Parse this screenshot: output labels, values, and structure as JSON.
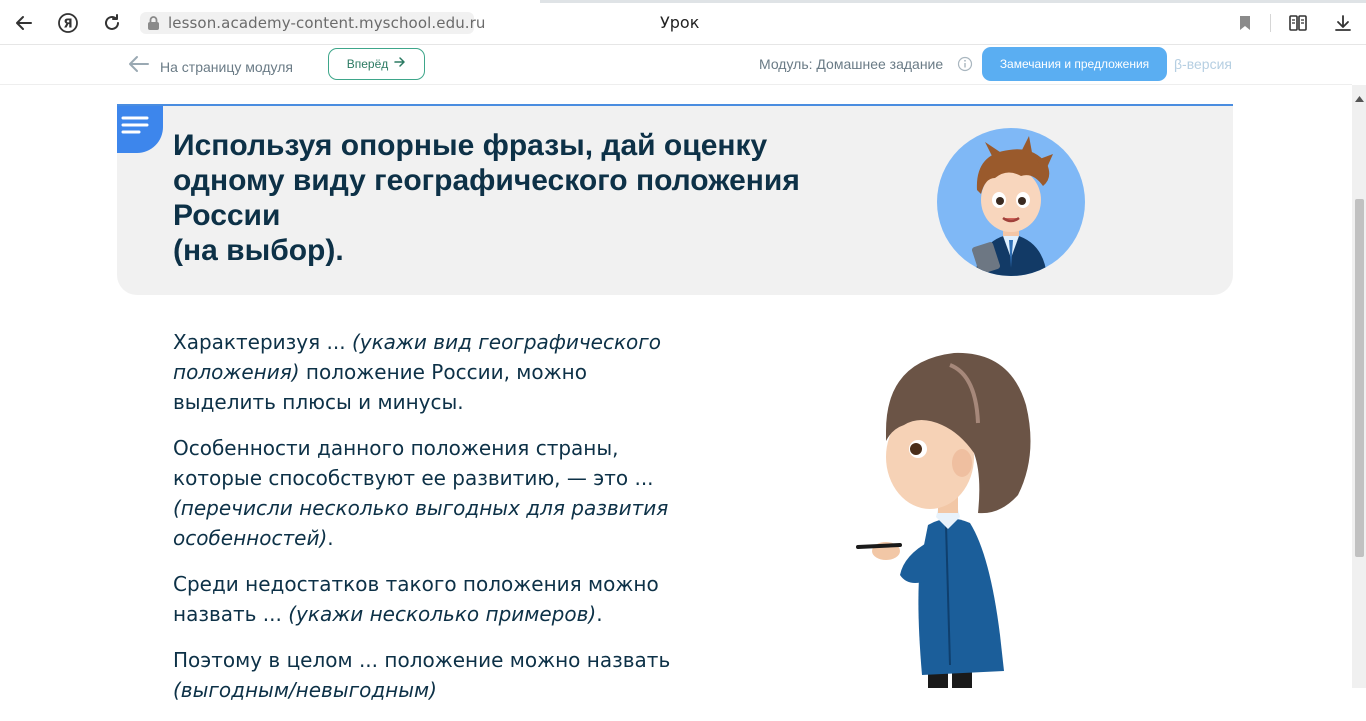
{
  "browser": {
    "address": "lesson.academy-content.myschool.edu.ru",
    "tab_title": "Урок"
  },
  "lesson_header": {
    "back_label": "На страницу модуля",
    "forward_label": "Вперёд",
    "module_label": "Модуль: Домашнее задание",
    "feedback_label": "Замечания и предложения",
    "beta_label": "β-версия"
  },
  "task": {
    "title_line1": "Используя опорные фразы, дай оценку",
    "title_line2": "одному виду географического положения",
    "title_line3": "России",
    "title_line4": "(на выбор)."
  },
  "body": {
    "p1_a": "Характеризуя ... ",
    "p1_b": "(укажи вид географического положения)",
    "p1_c": " положение России, можно выделить плюсы и минусы.",
    "p2_a": "Особенности данного положения страны, которые способствуют ее развитию, — это ... ",
    "p2_b": "(перечисли несколько выгодных для развития особенностей)",
    "p2_c": ".",
    "p3_a": "Среди недостатков такого положения можно назвать ... ",
    "p3_b": "(укажи несколько примеров)",
    "p3_c": ".",
    "p4_a": "Поэтому в целом ... положение можно назвать",
    "p4_b": "(выгодным/невыгодным)"
  },
  "colors": {
    "title": "#0d3147",
    "accent_blue": "#3d86ec",
    "feedback_button": "#5aaef2",
    "forward_border": "#3ea68a"
  }
}
